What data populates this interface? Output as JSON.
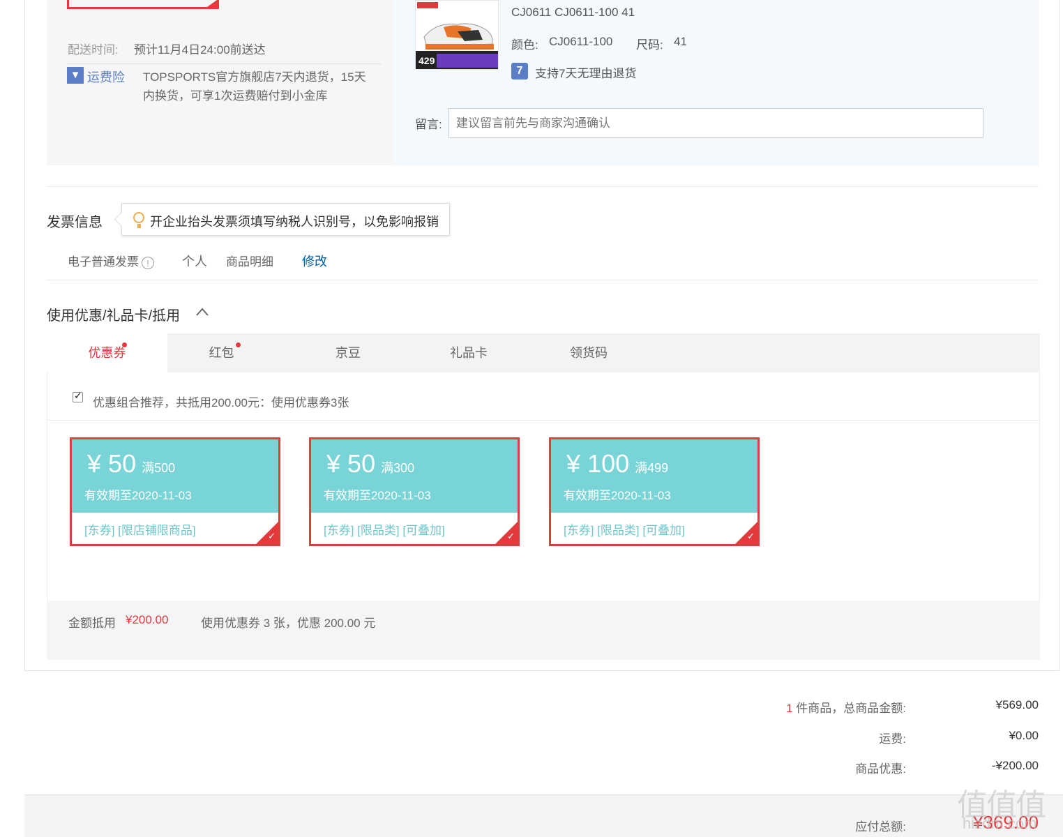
{
  "delivery": {
    "label": "配送时间:",
    "value": "预计11月4日24:00前送达",
    "insurance_label": "运费险",
    "insurance_text_line1": "TOPSPORTS官方旗舰店7天内退货，15天",
    "insurance_text_line2": "内换货，可享1次运费赔付到小金库"
  },
  "product": {
    "model": "CJ0611 CJ0611-100 41",
    "color_label": "颜色:",
    "color_value": "CJ0611-100",
    "size_label": "尺码:",
    "size_value": "41",
    "thumb_price": "429",
    "return_policy": "支持7天无理由退货",
    "memo_label": "留言:",
    "memo_placeholder": "建议留言前先与商家沟通确认"
  },
  "invoice": {
    "title": "发票信息",
    "tip": "开企业抬头发票须填写纳税人识别号，以免影响报销",
    "type": "电子普通发票",
    "info_glyph": "!",
    "holder": "个人",
    "content": "商品明细",
    "edit": "修改"
  },
  "discounts": {
    "title": "使用优惠/礼品卡/抵用",
    "tabs": [
      "优惠券",
      "红包",
      "京豆",
      "礼品卡",
      "领货码"
    ],
    "recommend_text": "优惠组合推荐，共抵用200.00元：使用优惠券3张",
    "coupons": [
      {
        "symbol": "¥",
        "amount": "50",
        "condition": "满500",
        "expiry": "有效期至2020-11-03",
        "tags": "[东券]  [限店铺限商品]"
      },
      {
        "symbol": "¥",
        "amount": "50",
        "condition": "满300",
        "expiry": "有效期至2020-11-03",
        "tags": "[东券]  [限品类]  [可叠加]"
      },
      {
        "symbol": "¥",
        "amount": "100",
        "condition": "满499",
        "expiry": "有效期至2020-11-03",
        "tags": "[东券]  [限品类]  [可叠加]"
      }
    ],
    "summary_label": "金额抵用",
    "summary_amount": "¥200.00",
    "summary_text": "使用优惠券 3 张，优惠 200.00 元"
  },
  "totals": {
    "count": "1",
    "count_suffix": " 件商品，总商品金额:",
    "goods_amount": "¥569.00",
    "shipping_label": "运费:",
    "shipping_amount": "¥0.00",
    "discount_label": "商品优惠:",
    "discount_amount": "-¥200.00",
    "payable_label": "应付总额:",
    "payable_amount": "¥369.00"
  },
  "watermark": {
    "glyphs": "值值值",
    "site": "hizdm.com"
  },
  "colors": {
    "accent": "#e4393c",
    "coupon_bg": "#78d4d6",
    "link": "#005ea7"
  }
}
